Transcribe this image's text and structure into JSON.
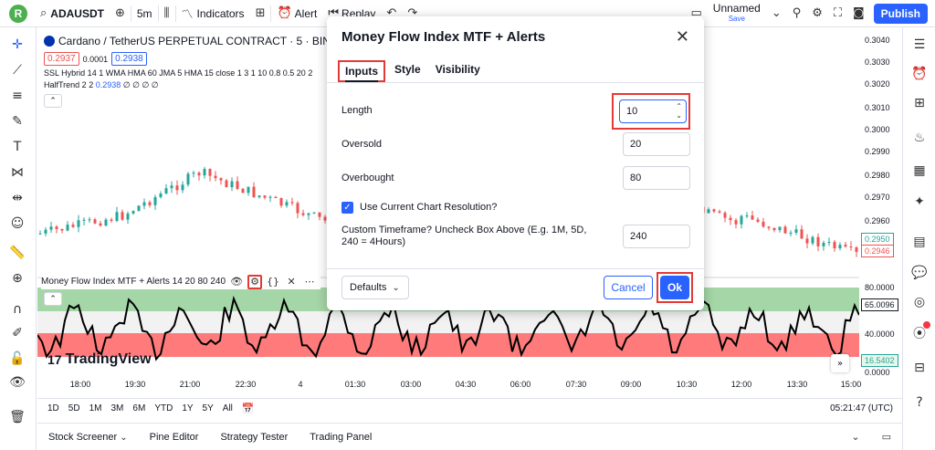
{
  "topbar": {
    "avatar_letter": "R",
    "symbol": "ADAUSDT",
    "interval": "5m",
    "indicators": "Indicators",
    "alert": "Alert",
    "replay": "Replay",
    "layout_name": "Unnamed",
    "save_label": "Save",
    "publish": "Publish",
    "icons": [
      "search-icon",
      "add-icon",
      "candles-icon",
      "indicators-icon",
      "templates-icon",
      "alert-icon",
      "replay-icon",
      "undo-icon",
      "redo-icon",
      "layout-icon",
      "quick-search-icon",
      "settings-icon",
      "fullscreen-icon",
      "snapshot-icon"
    ]
  },
  "legend": {
    "title": "Cardano / TetherUS PERPETUAL CONTRACT · 5 · BINANC",
    "bid": "0.2937",
    "spread": "0.0001",
    "ask": "0.2938",
    "ssl_line": "SSL Hybrid 14 1 WMA HMA 60 JMA 5 HMA 15 close 1 3 1 10 0.8 0.5 20 2",
    "halftrend_name": "HalfTrend 2 2",
    "halftrend_value": "0.2938",
    "halftrend_rest": "∅ ∅ ∅ ∅"
  },
  "price_scale": {
    "ticks": [
      "0.3040",
      "0.3030",
      "0.3020",
      "0.3010",
      "0.3000",
      "0.2990",
      "0.2980",
      "0.2970",
      "0.2960"
    ],
    "tag_green": "0.2950",
    "tag_red": "0.2946",
    "mfi_ticks": [
      "80.0000",
      "40.0000",
      "0.0000"
    ],
    "mfi_value": "65.0096",
    "mfi_low": "16.5402",
    "colors": {
      "green": "#26a69a",
      "red": "#ef5350"
    }
  },
  "mfi_pane": {
    "label": "Money Flow Index MTF + Alerts 14 20 80 240",
    "overbought_zone_color": "#a5d6a7",
    "oversold_zone_color": "#ff7b7b"
  },
  "time_axis": [
    "18:00",
    "19:30",
    "21:00",
    "22:30",
    "4",
    "01:30",
    "03:00",
    "04:30",
    "06:00",
    "07:30",
    "09:00",
    "10:30",
    "12:00",
    "13:30",
    "15:00"
  ],
  "watermark": "TradingView",
  "range_bar": {
    "items": [
      "1D",
      "5D",
      "1M",
      "3M",
      "6M",
      "YTD",
      "1Y",
      "5Y",
      "All"
    ],
    "clock": "05:21:47 (UTC)"
  },
  "bottom_tabs": [
    "Stock Screener",
    "Pine Editor",
    "Strategy Tester",
    "Trading Panel"
  ],
  "dialog": {
    "title": "Money Flow Index MTF + Alerts",
    "tabs": [
      "Inputs",
      "Style",
      "Visibility"
    ],
    "fields": {
      "length": {
        "label": "Length",
        "value": "10"
      },
      "oversold": {
        "label": "Oversold",
        "value": "20"
      },
      "overbought": {
        "label": "Overbought",
        "value": "80"
      },
      "use_current": {
        "label": "Use Current Chart Resolution?",
        "checked": true
      },
      "custom_tf": {
        "label": "Custom Timeframe? Uncheck Box Above (E.g. 1M, 5D, 240 = 4Hours)",
        "value": "240"
      }
    },
    "defaults": "Defaults",
    "cancel": "Cancel",
    "ok": "Ok"
  }
}
